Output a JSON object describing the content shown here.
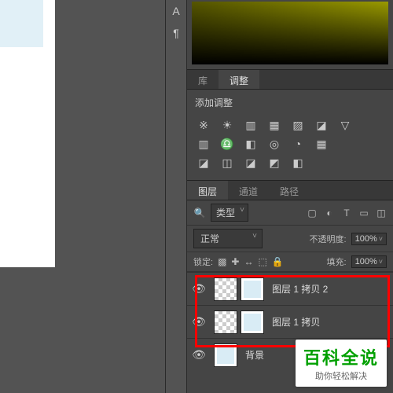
{
  "toolbar_glyphs": {
    "a": "A",
    "para": "¶"
  },
  "tabs_lib": {
    "lib": "库",
    "adjust": "调整"
  },
  "adjustments": {
    "title": "添加调整",
    "row1": [
      "※",
      "☀",
      "▥",
      "▦",
      "▨",
      "◪",
      "▽"
    ],
    "row2": [
      "▥",
      "♎",
      "◧",
      "◎",
      "◔",
      "▦"
    ],
    "row3": [
      "◪",
      "◫",
      "◪",
      "◩",
      "◧"
    ]
  },
  "layers_panel": {
    "tabs": {
      "layers": "图层",
      "channels": "通道",
      "paths": "路径"
    },
    "search_icon": "🔍",
    "kind": "类型",
    "filters": [
      "▢",
      "◐",
      "T",
      "▭",
      "◫"
    ],
    "blend": "正常",
    "opacity_label": "不透明度:",
    "opacity_value": "100%",
    "lock_label": "锁定:",
    "lock_icons": [
      "▩",
      "✚",
      "↔",
      "⬚",
      "🔒"
    ],
    "fill_label": "填充:",
    "fill_value": "100%",
    "layers": [
      {
        "name": "图层 1 拷贝 2"
      },
      {
        "name": "图层 1 拷贝"
      },
      {
        "name": "背景"
      }
    ]
  },
  "watermark": {
    "main": "百科全说",
    "sub": "助你轻松解决"
  }
}
